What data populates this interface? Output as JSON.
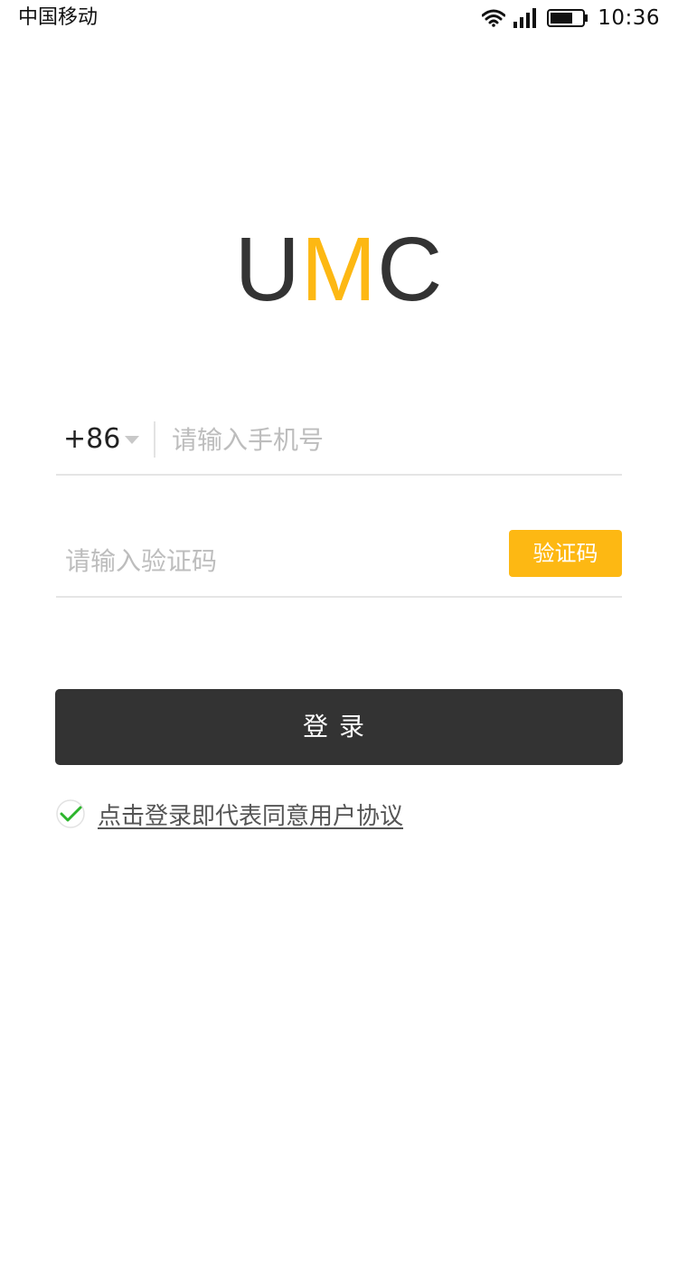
{
  "status_bar": {
    "carrier": "中国移动",
    "time": "10:36",
    "icons": [
      "wifi-icon",
      "signal-icon",
      "battery-icon"
    ]
  },
  "logo": {
    "letters": [
      "U",
      "M",
      "C"
    ],
    "accent_color": "#FDB813",
    "dark_color": "#333333"
  },
  "phone_field": {
    "country_code": "+86",
    "placeholder": "请输入手机号",
    "value": ""
  },
  "code_field": {
    "placeholder": "请输入验证码",
    "value": "",
    "button_label": "验证码"
  },
  "login": {
    "label": "登录"
  },
  "agreement": {
    "checked": true,
    "text": "点击登录即代表同意用户协议"
  }
}
